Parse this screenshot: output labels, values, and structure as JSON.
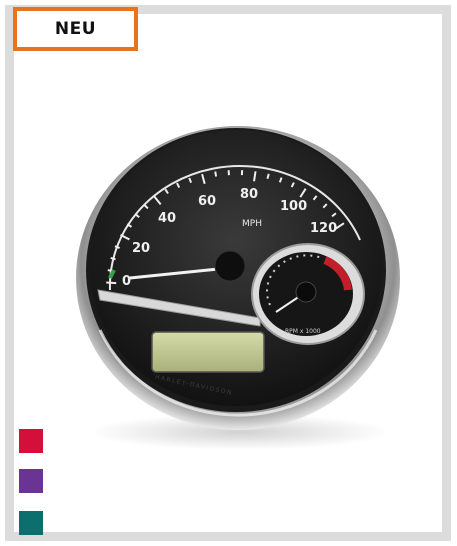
{
  "badge": {
    "label": "NEU"
  },
  "gauge": {
    "speed_labels": [
      "0",
      "20",
      "40",
      "60",
      "80",
      "100",
      "120"
    ],
    "unit_label": "MPH",
    "tach_label": "RPM x 1000",
    "brand_text": "HARLEY-DAVIDSON"
  },
  "swatches": [
    {
      "name": "red",
      "color": "#d40f3a"
    },
    {
      "name": "purple",
      "color": "#6a3494"
    },
    {
      "name": "teal",
      "color": "#0d6e6e"
    }
  ]
}
